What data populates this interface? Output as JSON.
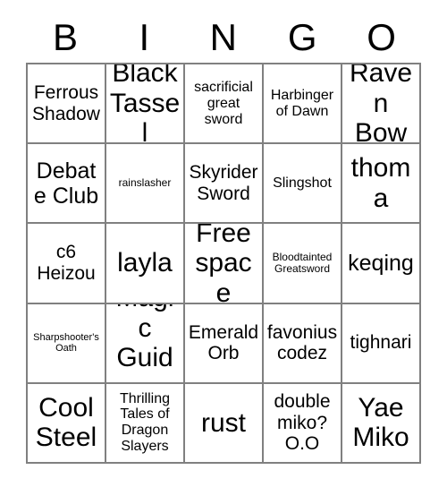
{
  "card": {
    "title": "BINGO",
    "header_letters": [
      "B",
      "I",
      "N",
      "G",
      "O"
    ],
    "border_color": "#808080",
    "background_color": "#ffffff",
    "text_color": "#000000",
    "rows": 5,
    "columns": 5,
    "cells": [
      {
        "text": "Ferrous Shadow",
        "size": "md"
      },
      {
        "text": "Black Tassel",
        "size": "xl"
      },
      {
        "text": "sacrificial great sword",
        "size": "sm"
      },
      {
        "text": "Harbinger of Dawn",
        "size": "sm"
      },
      {
        "text": "Raven Bow",
        "size": "xl"
      },
      {
        "text": "Debate Club",
        "size": "lg"
      },
      {
        "text": "rainslasher",
        "size": "xs"
      },
      {
        "text": "Skyrider Sword",
        "size": "md"
      },
      {
        "text": "Slingshot",
        "size": "sm"
      },
      {
        "text": "thoma",
        "size": "xl"
      },
      {
        "text": "c6 Heizou",
        "size": "md"
      },
      {
        "text": "layla",
        "size": "xl"
      },
      {
        "text": "Free space",
        "size": "xl"
      },
      {
        "text": "Bloodtainted Greatsword",
        "size": "xs"
      },
      {
        "text": "keqing",
        "size": "lg"
      },
      {
        "text": "Sharpshooter's Oath",
        "size": "xxs"
      },
      {
        "text": "Magic Guide",
        "size": "xl"
      },
      {
        "text": "Emerald Orb",
        "size": "md"
      },
      {
        "text": "favonius codez",
        "size": "md"
      },
      {
        "text": "tighnari",
        "size": "md"
      },
      {
        "text": "Cool Steel",
        "size": "xl"
      },
      {
        "text": "Thrilling Tales of Dragon Slayers",
        "size": "sm"
      },
      {
        "text": "rust",
        "size": "xl"
      },
      {
        "text": "double miko? O.O",
        "size": "md"
      },
      {
        "text": "Yae Miko",
        "size": "xl"
      }
    ]
  }
}
